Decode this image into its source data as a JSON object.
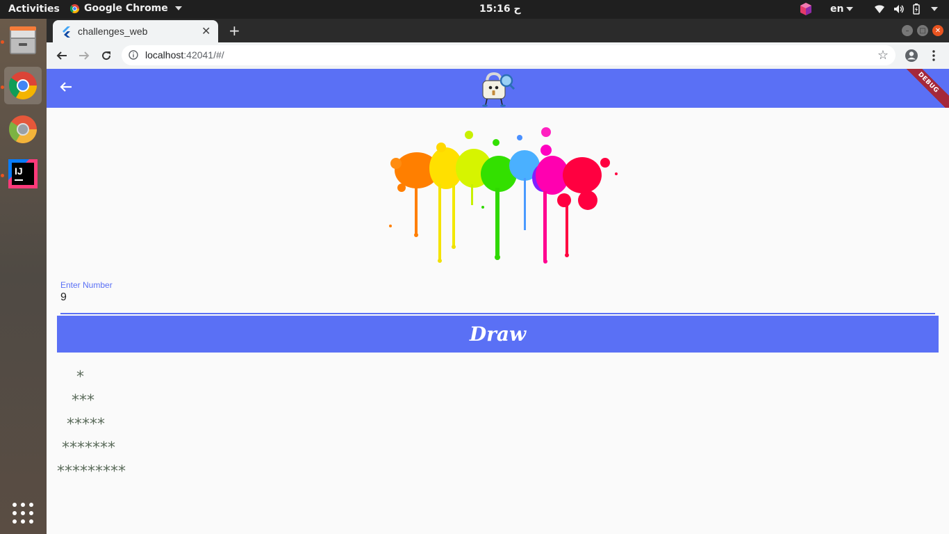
{
  "topbar": {
    "activities": "Activities",
    "app_name": "Google Chrome",
    "clock": "15:16 ح",
    "language": "en"
  },
  "dock": {
    "items": [
      "files-icon",
      "chrome-icon",
      "chrome-dev-icon",
      "intellij-icon",
      "app-grid-icon"
    ]
  },
  "browser": {
    "tab_title": "challenges_web",
    "url_host": "localhost",
    "url_rest": ":42041/#/"
  },
  "app": {
    "debug_banner": "DEBUG",
    "input_label": "Enter Number",
    "input_value": "9",
    "draw_button": "Draw",
    "pattern_rows": [
      "    *",
      "   ***",
      "  *****",
      " *******",
      "*********"
    ]
  },
  "colors": {
    "primary": "#5a70f5",
    "debug": "#a5283a",
    "pattern_text": "#5b6b5b"
  }
}
